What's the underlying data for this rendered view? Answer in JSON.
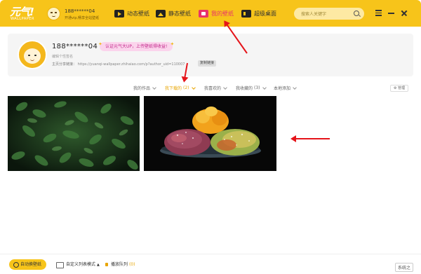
{
  "topbar": {
    "logo_text": "元气!",
    "logo_sub": "WALLPAPER",
    "username": "188******04",
    "vip_text": "开通vip,畅享全站壁纸",
    "nav": [
      {
        "label": "动态壁纸",
        "icon": "video-play-icon"
      },
      {
        "label": "静态壁纸",
        "icon": "image-icon"
      },
      {
        "label": "我的壁纸",
        "icon": "my-wallpaper-icon",
        "active": true
      },
      {
        "label": "超级桌面",
        "icon": "desktop-icon"
      }
    ],
    "search_placeholder": "搜索人关键字",
    "colors": {
      "bar": "#f7c41a",
      "active_nav": "#e8326a"
    }
  },
  "profile": {
    "name": "188******04",
    "promo_banner": "认证元气大UP，上传壁纸得收益!",
    "signature_placeholder": "编辑个性签名",
    "share_label": "主页分享链接：",
    "share_url": "https://yuanqi-wallpaper.zhihaiao.com/p?author_uid=110007",
    "copy_button": "复制链接"
  },
  "tabs": [
    {
      "label": "我的作品",
      "count": ""
    },
    {
      "label": "我下载的",
      "count": "(2)",
      "active": true
    },
    {
      "label": "我喜欢的",
      "count": ""
    },
    {
      "label": "我收藏的",
      "count": "(3)"
    },
    {
      "label": "本地添加",
      "count": ""
    }
  ],
  "manage_button": "管理",
  "wallpapers": [
    {
      "name": "green-leaves-wallpaper"
    },
    {
      "name": "mango-fruit-wallpaper"
    }
  ],
  "bottombar": {
    "auto_change": "自动换壁纸",
    "list_mode": "自定义列表模式",
    "play_queue": "播放队列",
    "play_queue_count": "(0)"
  },
  "watermark": "系统之"
}
